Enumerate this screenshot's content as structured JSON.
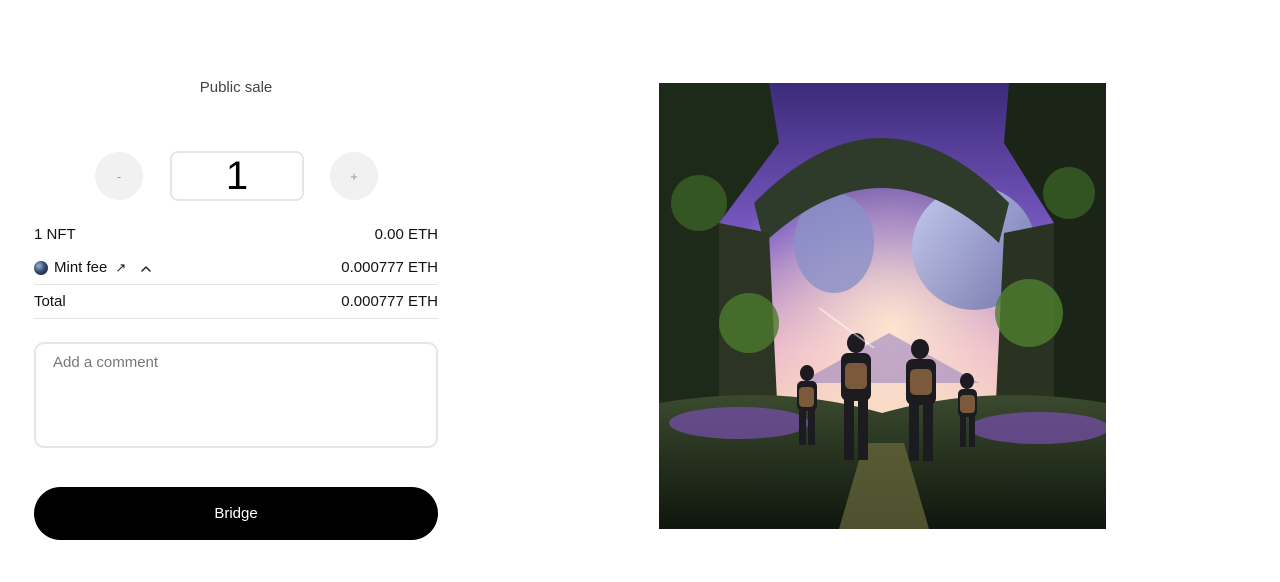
{
  "sale": {
    "title": "Public sale"
  },
  "quantity": {
    "minus_label": "-",
    "value": "1",
    "plus_label": "+"
  },
  "summary": {
    "nft_label": "1 NFT",
    "nft_price": "0.00 ETH",
    "fee_label": "Mint fee",
    "fee_arrow": "↗",
    "fee_value": "0.000777 ETH",
    "total_label": "Total",
    "total_value": "0.000777 ETH"
  },
  "comment": {
    "placeholder": "Add a comment",
    "value": ""
  },
  "action": {
    "bridge_label": "Bridge"
  },
  "icons": {
    "fee_icon": "globe-icon",
    "fee_link": "external-link-icon",
    "fee_toggle": "chevron-up-icon"
  },
  "colors": {
    "primary_button": "#000000",
    "stepper_bg": "#f1f1f1"
  }
}
